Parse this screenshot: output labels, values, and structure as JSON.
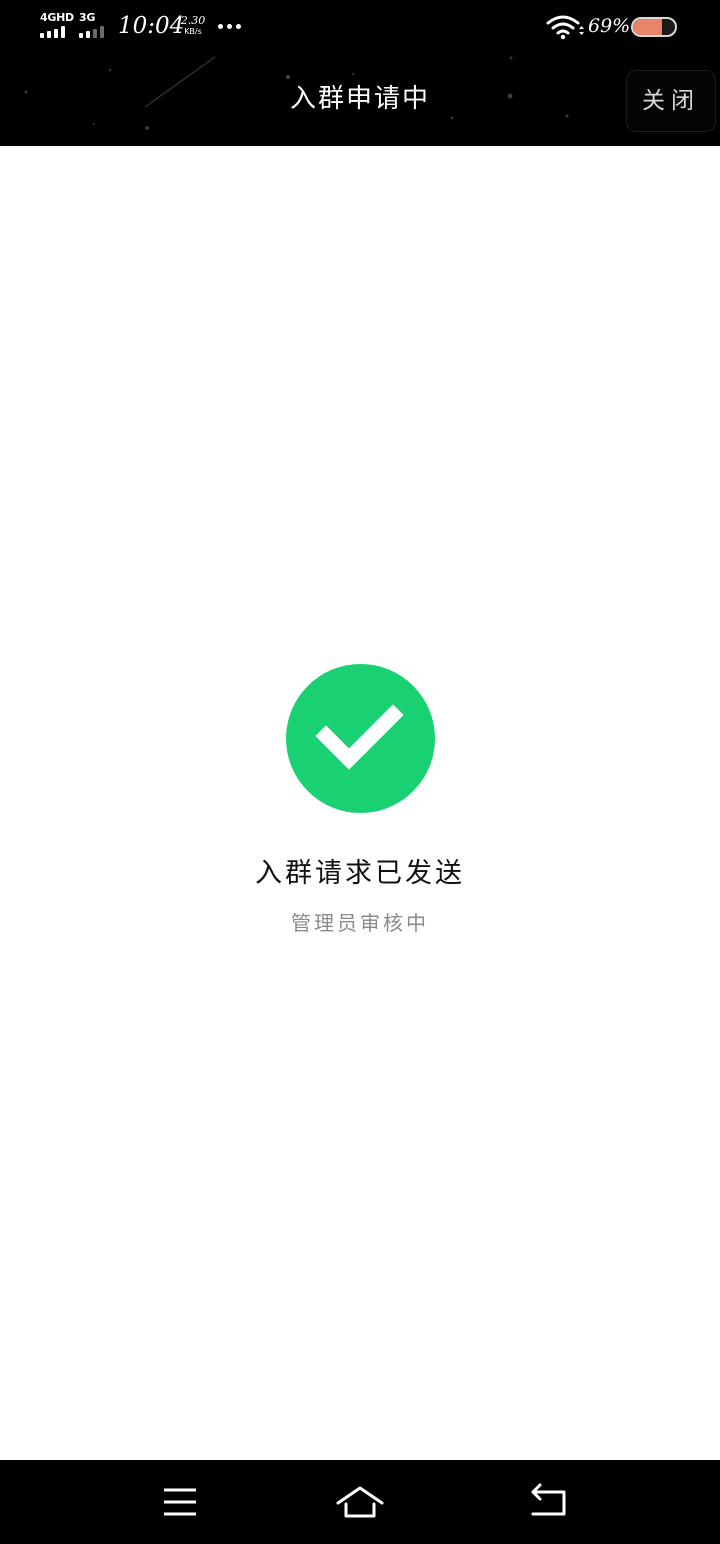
{
  "status_bar": {
    "network_primary": "4GHD",
    "network_secondary": "3G",
    "time": "10:04",
    "net_speed_value": "2.30",
    "net_speed_unit": "KB/s",
    "battery_percent": "69%",
    "battery_level": 0.69
  },
  "header": {
    "title": "入群申请中",
    "close_label": "关闭"
  },
  "result": {
    "title": "入群请求已发送",
    "subtitle": "管理员审核中"
  },
  "icons": {
    "success": "check-circle-icon",
    "nav_menu": "menu-icon",
    "nav_home": "home-icon",
    "nav_back": "back-icon"
  },
  "colors": {
    "header_bg": "#000000",
    "page_bg": "#ffffff",
    "success_green": "#19d173",
    "subtitle_gray": "#8a8a8a",
    "battery_fill": "#e8846a"
  }
}
